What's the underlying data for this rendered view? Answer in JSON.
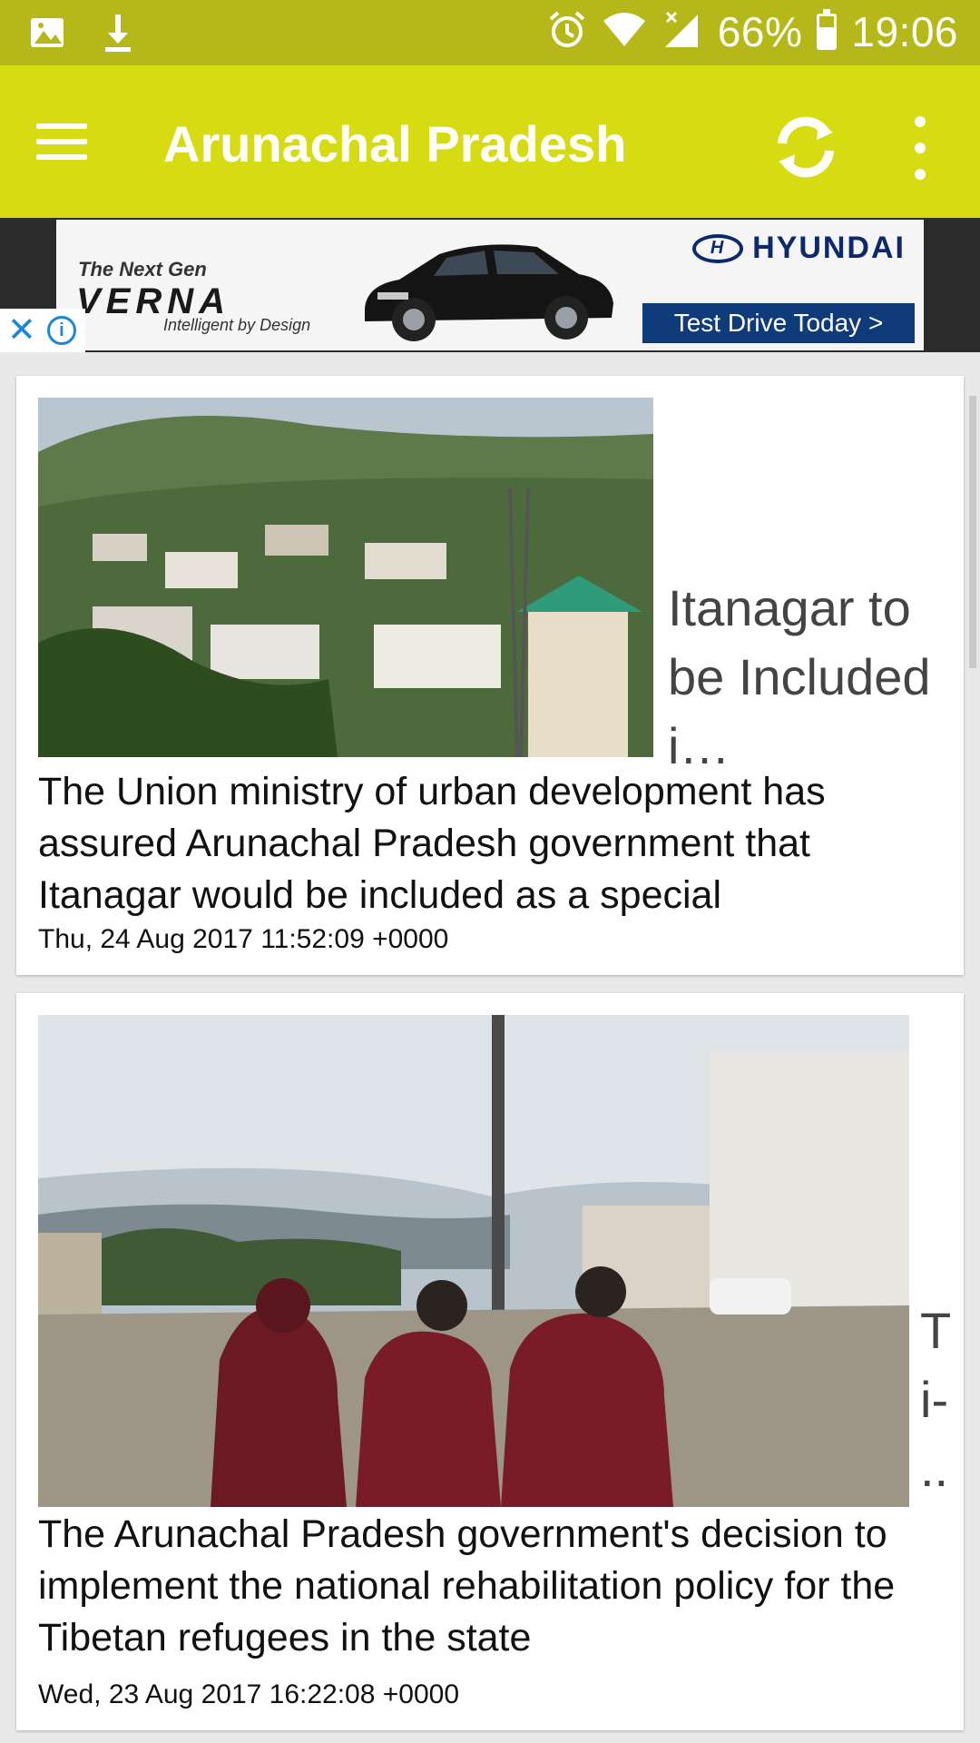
{
  "status_bar": {
    "battery_percent": "66%",
    "battery_level": 0.66,
    "time": "19:06",
    "icons": [
      "image-icon",
      "download-icon",
      "alarm-icon",
      "wifi-icon",
      "signal-icon",
      "battery-icon"
    ],
    "background": "#b6b81a"
  },
  "app_bar": {
    "title": "Arunachal Pradesh",
    "background": "#d7dc12",
    "icons": [
      "menu-icon",
      "refresh-icon",
      "more-vert-icon"
    ]
  },
  "ad": {
    "headline": "The Next Gen",
    "model": "VERNA",
    "tagline": "Intelligent by Design",
    "brand": "HYUNDAI",
    "cta": "Test Drive Today >"
  },
  "articles": [
    {
      "side_title": "Itanagar to be Included i…",
      "summary": "The Union ministry of urban development has assured Arunachal Pradesh government that Itanagar would be included as a special",
      "date": "Thu, 24 Aug 2017 11:52:09 +0000"
    },
    {
      "side_title": "T i- ..",
      "summary": "The Arunachal Pradesh government's decision to implement the national rehabilitation policy for the Tibetan refugees in the state",
      "date": "Wed, 23 Aug 2017 16:22:08 +0000"
    }
  ]
}
